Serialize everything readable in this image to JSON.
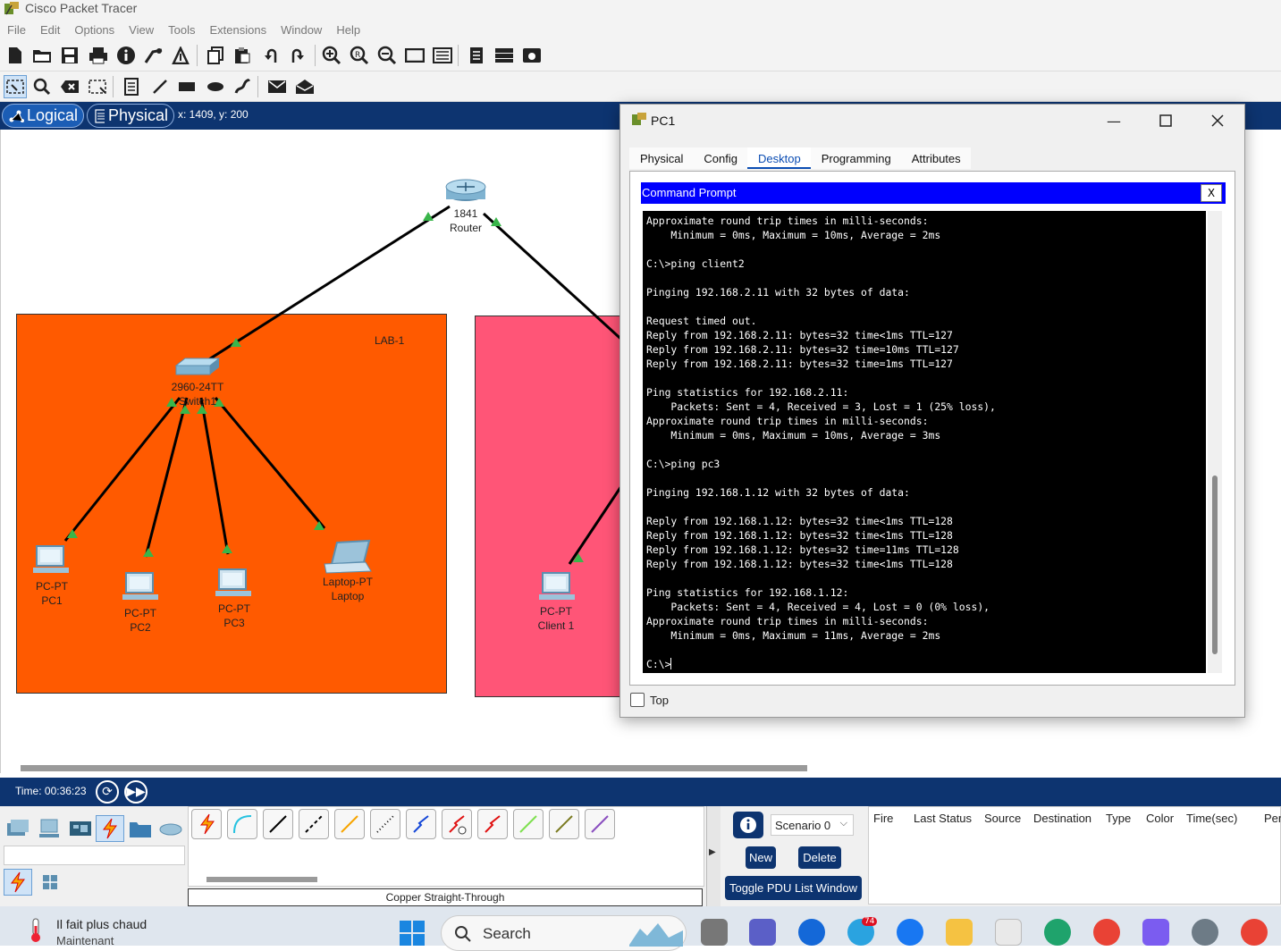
{
  "app": {
    "title": "Cisco Packet Tracer"
  },
  "menu": [
    "File",
    "Edit",
    "Options",
    "View",
    "Tools",
    "Extensions",
    "Window",
    "Help"
  ],
  "modes": {
    "logical": "Logical",
    "physical": "Physical",
    "coords": "x: 1409, y: 200"
  },
  "workspace": {
    "router": {
      "line1": "1841",
      "line2": "Router"
    },
    "switch": {
      "line1": "2960-24TT",
      "line2": "Switch1"
    },
    "lab1": {
      "label": "LAB-1",
      "color": "#ff5a00"
    },
    "lab2": {
      "color": "#ff5577"
    },
    "devices": [
      {
        "type": "PC-PT",
        "name": "PC1"
      },
      {
        "type": "PC-PT",
        "name": "PC2"
      },
      {
        "type": "PC-PT",
        "name": "PC3"
      },
      {
        "type": "Laptop-PT",
        "name": "Laptop"
      },
      {
        "type": "PC-PT",
        "name": "Client 1"
      }
    ],
    "link_color": "#39b54a"
  },
  "timebar": {
    "time": "Time: 00:36:23"
  },
  "bottom": {
    "cable_name": "Copper Straight-Through",
    "scenario": "Scenario 0",
    "new_label": "New",
    "delete_label": "Delete",
    "toggle_label": "Toggle PDU List Window",
    "columns": [
      "Fire",
      "Last Status",
      "Source",
      "Destination",
      "Type",
      "Color",
      "Time(sec)",
      "Periodic"
    ]
  },
  "taskbar": {
    "weather_line1": "Il fait plus chaud",
    "weather_line2": "Maintenant",
    "search": "Search",
    "badge": "74"
  },
  "pc_window": {
    "title": "PC1",
    "tabs": [
      "Physical",
      "Config",
      "Desktop",
      "Programming",
      "Attributes"
    ],
    "active_tab": "Desktop",
    "cmd_title": "Command Prompt",
    "cmd_close": "X",
    "top_label": "Top",
    "terminal": "Approximate round trip times in milli-seconds:\n    Minimum = 0ms, Maximum = 10ms, Average = 2ms\n\nC:\\>ping client2\n\nPinging 192.168.2.11 with 32 bytes of data:\n\nRequest timed out.\nReply from 192.168.2.11: bytes=32 time<1ms TTL=127\nReply from 192.168.2.11: bytes=32 time=10ms TTL=127\nReply from 192.168.2.11: bytes=32 time=1ms TTL=127\n\nPing statistics for 192.168.2.11:\n    Packets: Sent = 4, Received = 3, Lost = 1 (25% loss),\nApproximate round trip times in milli-seconds:\n    Minimum = 0ms, Maximum = 10ms, Average = 3ms\n\nC:\\>ping pc3\n\nPinging 192.168.1.12 with 32 bytes of data:\n\nReply from 192.168.1.12: bytes=32 time<1ms TTL=128\nReply from 192.168.1.12: bytes=32 time<1ms TTL=128\nReply from 192.168.1.12: bytes=32 time=11ms TTL=128\nReply from 192.168.1.12: bytes=32 time<1ms TTL=128\n\nPing statistics for 192.168.1.12:\n    Packets: Sent = 4, Received = 4, Lost = 0 (0% loss),\nApproximate round trip times in milli-seconds:\n    Minimum = 0ms, Maximum = 11ms, Average = 2ms\n\nC:\\>"
  }
}
